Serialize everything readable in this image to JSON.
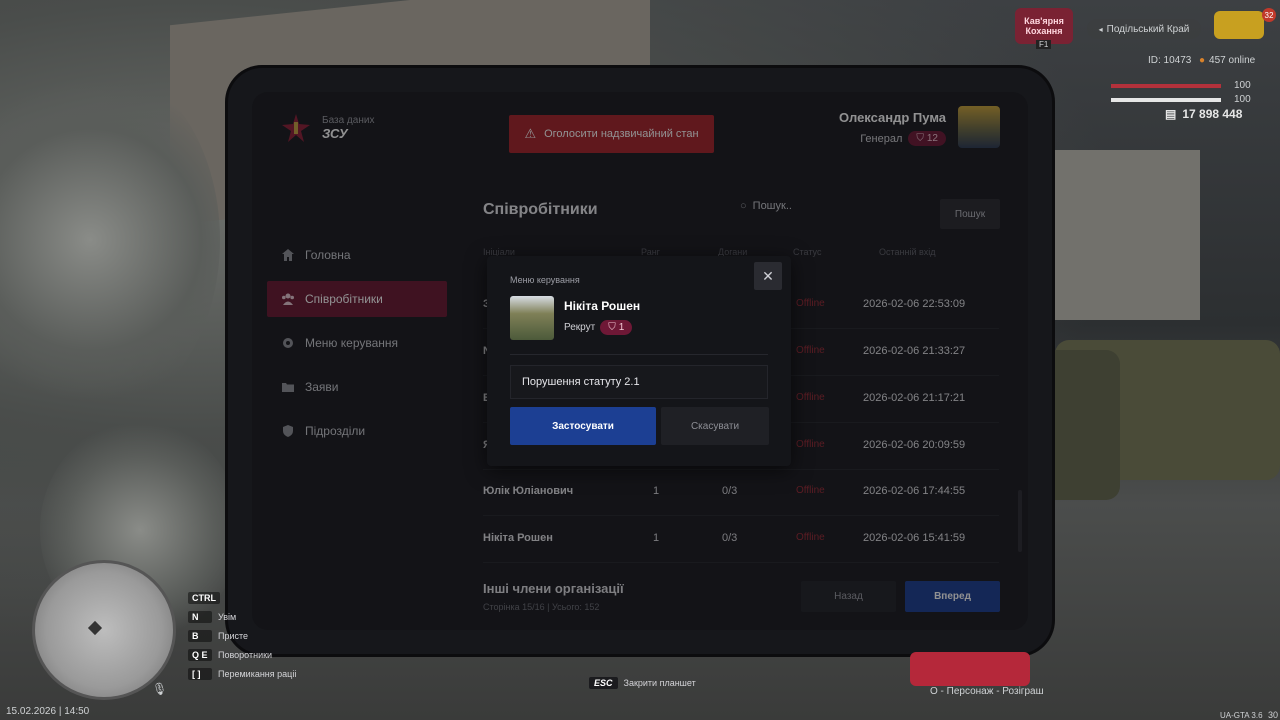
{
  "hud": {
    "server_name": "Подільський Край",
    "player_id": "ID: 10473",
    "online": "457 online",
    "health": "100",
    "armor": "100",
    "money": "17 898 448",
    "event_key": "F1",
    "event_title": "Кав'ярня Кохання",
    "date_time": "15.02.2026 | 14:50",
    "version": "UA-GTA 3.6",
    "level_badge": "32",
    "side_num": "30",
    "giveaway_label": "O - Персонаж - Розіграш",
    "close_tablet_key": "ESC",
    "close_tablet_label": "Закрити планшет",
    "keybinds": [
      {
        "key": "CTRL",
        "label": ""
      },
      {
        "key": "N",
        "label": "Увім"
      },
      {
        "key": "B",
        "label": "Присте"
      },
      {
        "key": "Q E",
        "label": "Поворотники"
      },
      {
        "key": "[ ]",
        "label": "Перемикання раціі"
      }
    ]
  },
  "tablet": {
    "org_subtitle": "База даних",
    "org_name": "ЗСУ",
    "emergency_button": "Оголосити надзвичайний стан",
    "user_name": "Олександр Пума",
    "user_rank": "Генерал",
    "user_rank_level": "12",
    "nav": [
      {
        "label": "Головна",
        "icon": "home-icon"
      },
      {
        "label": "Співробітники",
        "icon": "users-icon",
        "active": true
      },
      {
        "label": "Меню керування",
        "icon": "gear-icon"
      },
      {
        "label": "Заяви",
        "icon": "folder-icon"
      },
      {
        "label": "Підрозділи",
        "icon": "shield-icon"
      }
    ],
    "section_title": "Співробітники",
    "search_placeholder": "Пошук..",
    "search_button": "Пошук",
    "columns": [
      "Ініціали",
      "Ранг",
      "Догани",
      "Статус",
      "Останній вхід"
    ],
    "rows": [
      {
        "name": "З",
        "rank": "",
        "warns": "",
        "status": "Offline",
        "last_login": "2026-02-06 22:53:09"
      },
      {
        "name": "N",
        "rank": "",
        "warns": "",
        "status": "Offline",
        "last_login": "2026-02-06 21:33:27"
      },
      {
        "name": "В",
        "rank": "",
        "warns": "",
        "status": "Offline",
        "last_login": "2026-02-06 21:17:21"
      },
      {
        "name": "Я",
        "rank": "",
        "warns": "",
        "status": "Offline",
        "last_login": "2026-02-06 20:09:59"
      },
      {
        "name": "Юлік Юліанович",
        "rank": "1",
        "warns": "0/3",
        "status": "Offline",
        "last_login": "2026-02-06 17:44:55"
      },
      {
        "name": "Нікіта Рошен",
        "rank": "1",
        "warns": "0/3",
        "status": "Offline",
        "last_login": "2026-02-06 15:41:59"
      }
    ],
    "other_members": "Інші члени організації",
    "page_info": "Сторінка 15/16 | Усього: 152",
    "back_button": "Назад",
    "forward_button": "Вперед"
  },
  "modal": {
    "title": "Меню керування",
    "close_glyph": "✕",
    "member_name": "Нікіта Рошен",
    "member_rank": "Рекрут",
    "member_rank_level": "1",
    "reason_value": "Порушення статуту 2.1",
    "apply_button": "Застосувати",
    "cancel_button": "Скасувати"
  }
}
